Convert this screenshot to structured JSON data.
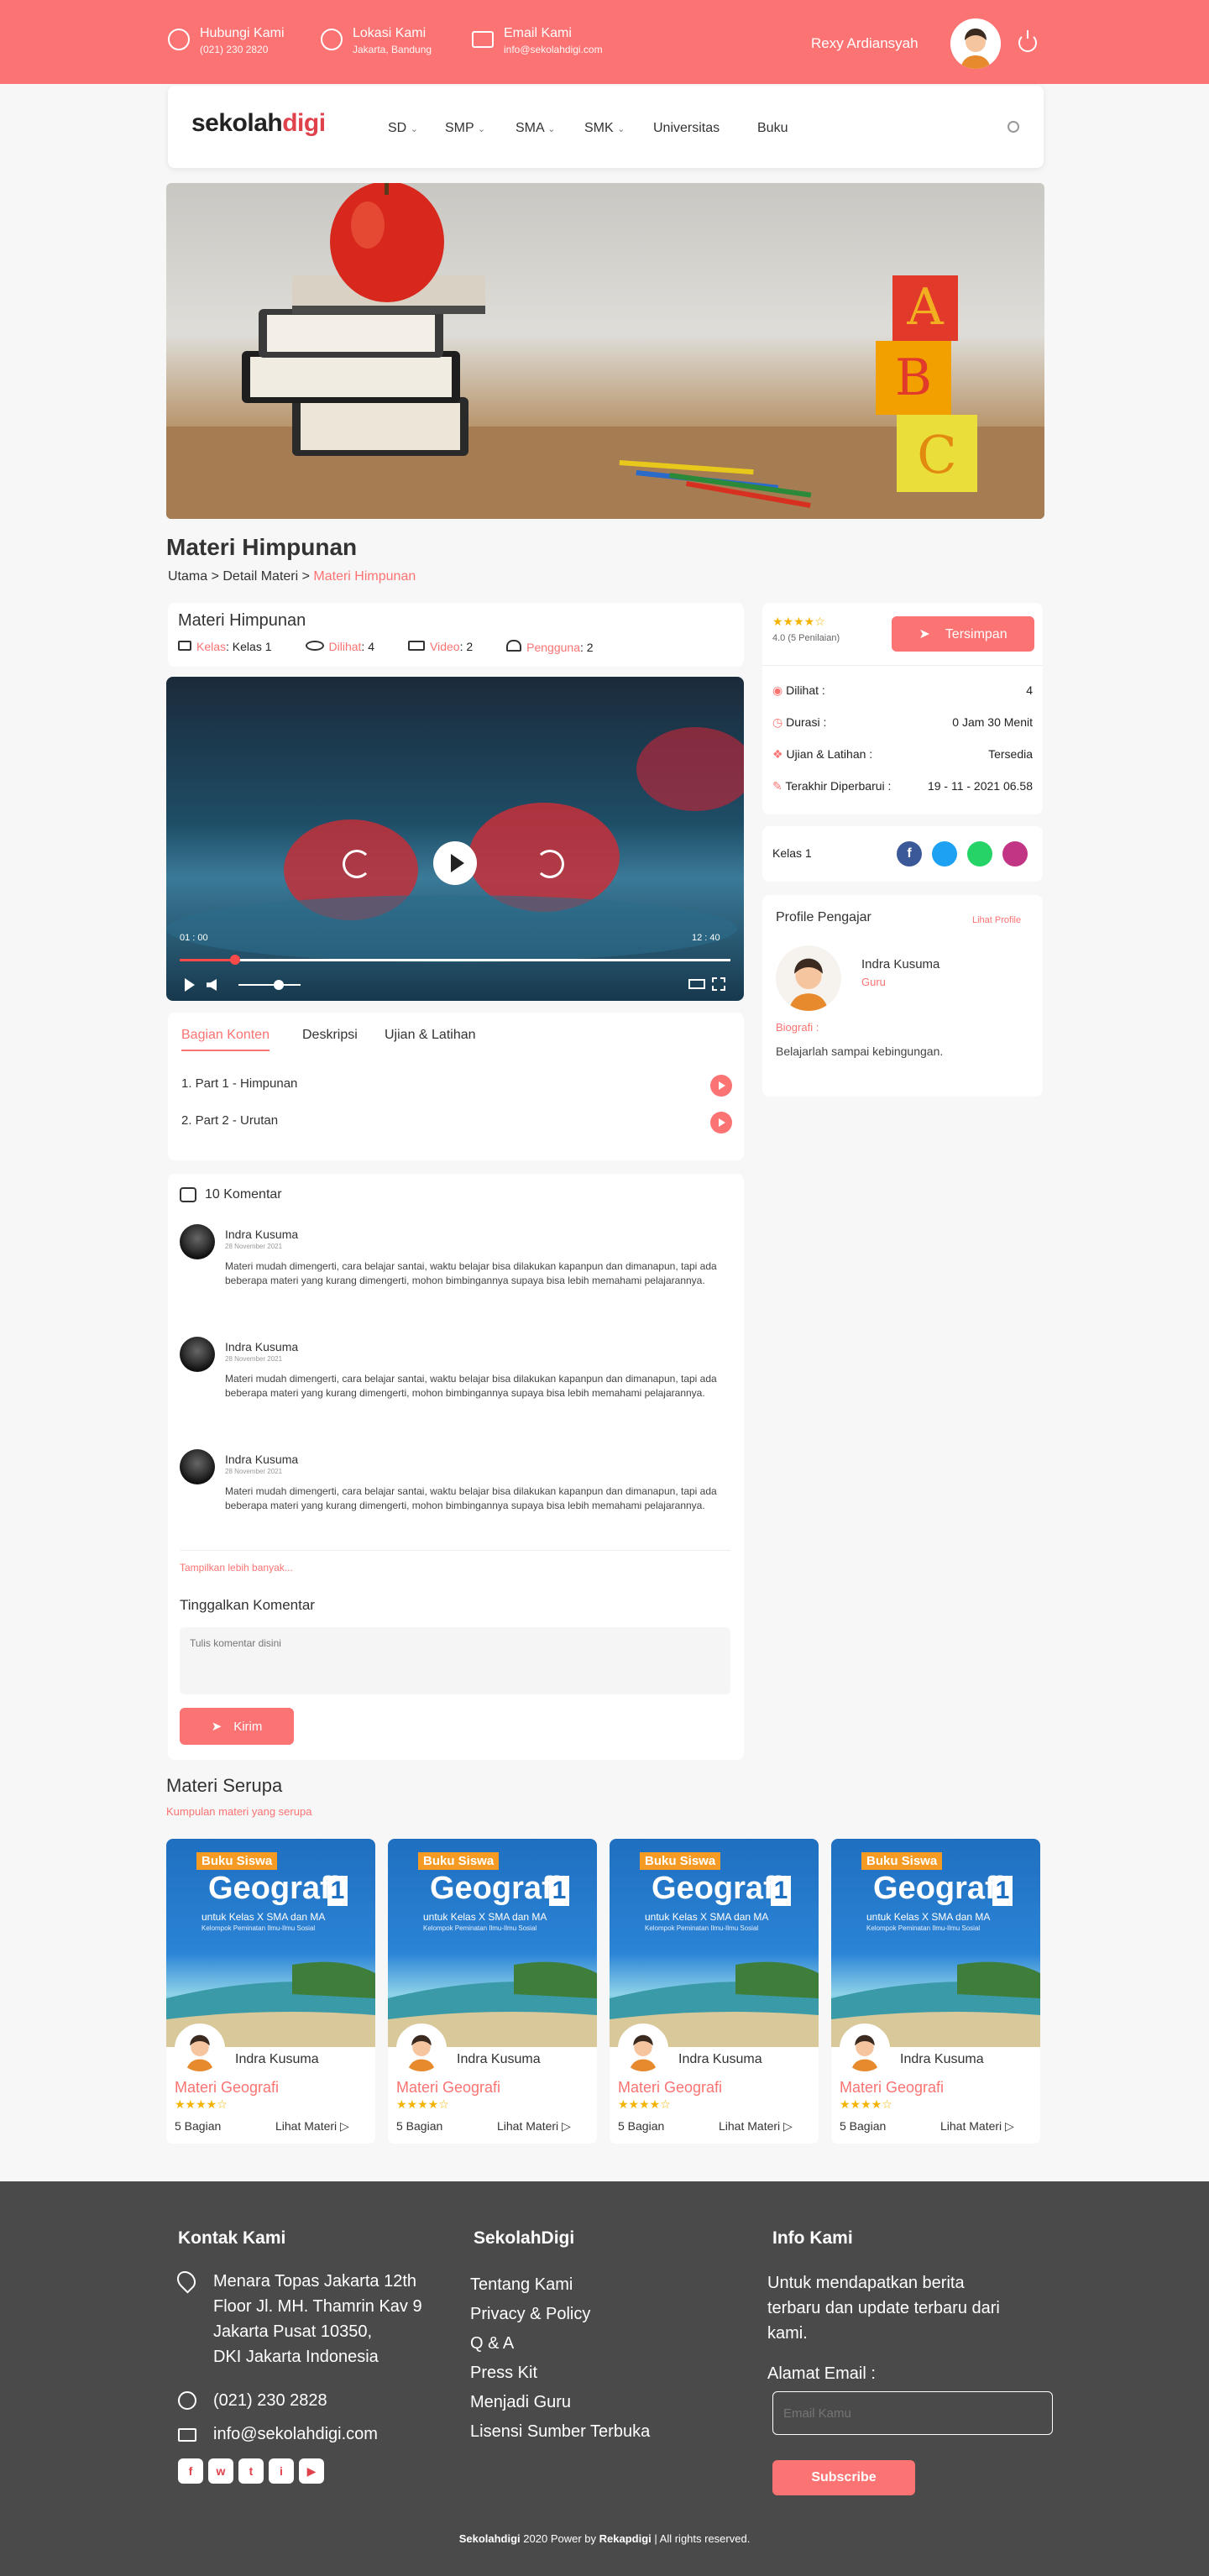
{
  "topbar": {
    "contact_title": "Hubungi Kami",
    "contact_value": "(021) 230 2820",
    "location_title": "Lokasi Kami",
    "location_value": "Jakarta, Bandung",
    "email_title": "Email Kami",
    "email_value": "info@sekolahdigi.com",
    "user_name": "Rexy Ardiansyah"
  },
  "nav": {
    "logo_a": "sekolah",
    "logo_b": "digi",
    "items": [
      "SD",
      "SMP",
      "SMA",
      "SMK",
      "Universitas",
      "Buku"
    ]
  },
  "page": {
    "title": "Materi Himpunan",
    "crumb_1": "Utama",
    "crumb_2": "Detail Materi",
    "crumb_3": "Materi Himpunan"
  },
  "info": {
    "title": "Materi Himpunan",
    "kelas_label": "Kelas",
    "kelas_value": ": Kelas 1",
    "dilihat_label": "Dilihat",
    "dilihat_value": ": 4",
    "video_label": "Video",
    "video_value": ": 2",
    "pengguna_label": "Pengguna",
    "pengguna_value": ": 2"
  },
  "player": {
    "current": "01 : 00",
    "duration": "12 : 40",
    "progress": 0.1,
    "volume": 0.65
  },
  "tabs": {
    "items": [
      "Bagian Konten",
      "Deskripsi",
      "Ujian & Latihan"
    ],
    "parts": [
      "1. Part 1 - Himpunan",
      "2. Part 2 - Urutan"
    ]
  },
  "comments": {
    "count_label": "10 Komentar",
    "items": [
      {
        "name": "Indra Kusuma",
        "date": "28 November 2021",
        "text": "Materi mudah dimengerti, cara belajar santai, waktu belajar bisa dilakukan kapanpun dan dimanapun, tapi ada beberapa materi yang kurang dimengerti, mohon bimbingannya supaya bisa lebih memahami pelajarannya."
      },
      {
        "name": "Indra Kusuma",
        "date": "28 November 2021",
        "text": "Materi mudah dimengerti, cara belajar santai, waktu belajar bisa dilakukan kapanpun dan dimanapun, tapi ada beberapa materi yang kurang dimengerti, mohon bimbingannya supaya bisa lebih memahami pelajarannya."
      },
      {
        "name": "Indra Kusuma",
        "date": "28 November 2021",
        "text": "Materi mudah dimengerti, cara belajar santai, waktu belajar bisa dilakukan kapanpun dan dimanapun, tapi ada beberapa materi yang kurang dimengerti, mohon bimbingannya supaya bisa lebih memahami pelajarannya."
      }
    ],
    "more": "Tampilkan lebih banyak...",
    "leave_title": "Tinggalkan Komentar",
    "placeholder": "Tulis komentar disini",
    "send": "Kirim"
  },
  "side": {
    "rating_label": "4.0 (5 Penilaian)",
    "rating": 4,
    "save": "Tersimpan",
    "stats": [
      {
        "label": "Dilihat :",
        "value": "4"
      },
      {
        "label": "Durasi :",
        "value": "0 Jam 30 Menit"
      },
      {
        "label": "Ujian & Latihan :",
        "value": "Tersedia"
      },
      {
        "label": "Terakhir Diperbarui :",
        "value": "19 - 11 - 2021 06.58"
      }
    ],
    "kelas": "Kelas 1",
    "profile_title": "Profile Pengajar",
    "profile_link": "Lihat Profile",
    "teacher_name": "Indra Kusuma",
    "teacher_role": "Guru",
    "bio_label": "Biografi :",
    "bio_text": "Belajarlah sampai kebingungan."
  },
  "similar": {
    "title": "Materi Serupa",
    "subtitle": "Kumpulan materi yang serupa",
    "cover_tag": "Buku Siswa",
    "cover_title": "Geografi",
    "cover_num": "1",
    "cover_sub": "untuk Kelas X SMA dan MA",
    "cover_sub2": "Kelompok Peminatan Ilmu-Ilmu Sosial",
    "cards": [
      {
        "author": "Indra Kusuma",
        "title": "Materi Geografi",
        "parts": "5 Bagian",
        "link": "Lihat Materi"
      },
      {
        "author": "Indra Kusuma",
        "title": "Materi Geografi",
        "parts": "5 Bagian",
        "link": "Lihat Materi"
      },
      {
        "author": "Indra Kusuma",
        "title": "Materi Geografi",
        "parts": "5 Bagian",
        "link": "Lihat Materi"
      },
      {
        "author": "Indra Kusuma",
        "title": "Materi Geografi",
        "parts": "5 Bagian",
        "link": "Lihat Materi"
      }
    ]
  },
  "footer": {
    "contact_title": "Kontak Kami",
    "address": [
      "Menara Topas Jakarta 12th",
      "Floor Jl. MH. Thamrin Kav 9",
      "Jakarta Pusat 10350,",
      "DKI Jakarta Indonesia"
    ],
    "phone": "(021) 230 2828",
    "email": "info@sekolahdigi.com",
    "col2_title": "SekolahDigi",
    "links": [
      "Tentang Kami",
      "Privacy & Policy",
      "Q & A",
      "Press Kit",
      "Menjadi Guru",
      "Lisensi Sumber Terbuka"
    ],
    "col3_title": "Info Kami",
    "info_text": [
      "Untuk mendapatkan berita",
      "terbaru dan update terbaru dari",
      "kami."
    ],
    "email_label": "Alamat Email :",
    "email_placeholder": "Email Kamu",
    "subscribe": "Subscribe",
    "copy_brand": "Sekolahdigi",
    "copy_mid": "2020 Power by",
    "copy_brand2": "Rekapdigi",
    "copy_end": "| All rights reserved."
  },
  "colors": {
    "accent": "#fb7372",
    "footer": "#4a4a4a",
    "star": "#f5b301"
  }
}
